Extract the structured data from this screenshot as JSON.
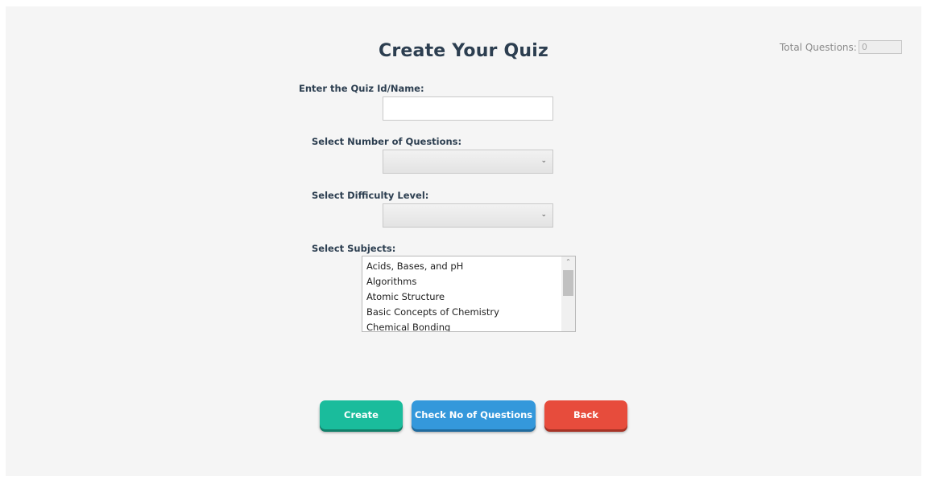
{
  "page": {
    "title": "Create Your Quiz"
  },
  "total_questions": {
    "label": "Total Questions:",
    "value": "0"
  },
  "form": {
    "quiz_name_label": "Enter the Quiz Id/Name:",
    "quiz_name_value": "",
    "num_questions_label": "Select Number of Questions:",
    "num_questions_selected": "",
    "difficulty_label": "Select Difficulty Level:",
    "difficulty_selected": "",
    "subjects_label": "Select Subjects:",
    "subjects": [
      "Acids, Bases, and pH",
      "Algorithms",
      "Atomic Structure",
      "Basic Concepts of Chemistry",
      "Chemical Bonding"
    ]
  },
  "buttons": {
    "create": "Create",
    "check": "Check No of Questions",
    "back": "Back"
  },
  "colors": {
    "create": "#1abc9c",
    "check": "#3498db",
    "back": "#e74c3c",
    "title": "#2c3e50"
  }
}
